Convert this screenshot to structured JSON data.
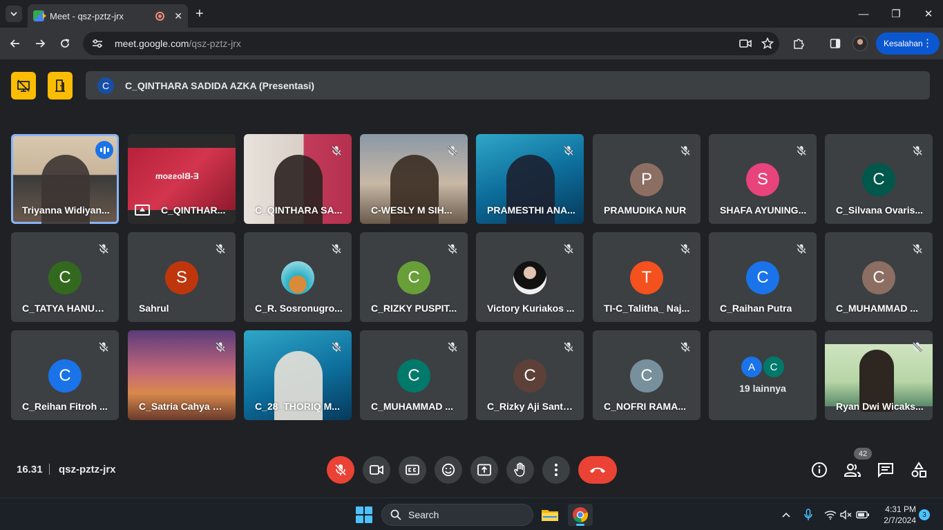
{
  "browser": {
    "tab_title": "Meet - qsz-pztz-jrx",
    "tab_close": "✕",
    "new_tab": "+",
    "url_domain": "meet.google.com",
    "url_path": "/qsz-pztz-jrx",
    "error_label": "Kesalahan",
    "error_menu": "⋮",
    "window_controls": {
      "minimize": "—",
      "restore": "❐",
      "close": "✕"
    }
  },
  "meet": {
    "presenter_initial": "C",
    "presenter_label": "C_QINTHARA SADIDA AZKA (Presentasi)",
    "tiles": [
      {
        "name": "Triyanna Widiyan...",
        "kind": "video",
        "speaking": true
      },
      {
        "name": "C_QINTHAR...",
        "kind": "presentation",
        "slide_text": "E-Blossom"
      },
      {
        "name": "C_QINTHARA SA...",
        "kind": "video"
      },
      {
        "name": "C-WESLY M SIH...",
        "kind": "video"
      },
      {
        "name": "PRAMESTHI ANA...",
        "kind": "video"
      },
      {
        "name": "PRAMUDIKA NUR",
        "kind": "avatar",
        "initial": "P",
        "color": "#8d6e63"
      },
      {
        "name": "SHAFA AYUNING...",
        "kind": "avatar",
        "initial": "S",
        "color": "#e8437a"
      },
      {
        "name": "C_Silvana Ovaris...",
        "kind": "avatar",
        "initial": "C",
        "color": "#00574b"
      },
      {
        "name": "C_TATYA HANUM...",
        "kind": "avatar",
        "initial": "C",
        "color": "#33691e"
      },
      {
        "name": "Sahrul",
        "kind": "avatar",
        "initial": "S",
        "color": "#bf360c"
      },
      {
        "name": "C_R. Sosronugro...",
        "kind": "photo-avatar"
      },
      {
        "name": "C_RIZKY PUSPIT...",
        "kind": "avatar",
        "initial": "C",
        "color": "#689f38"
      },
      {
        "name": "Victory Kuriakos ...",
        "kind": "photo-avatar"
      },
      {
        "name": "TI-C_Talitha_ Naj...",
        "kind": "avatar",
        "initial": "T",
        "color": "#f4511e"
      },
      {
        "name": "C_Raihan Putra",
        "kind": "avatar",
        "initial": "C",
        "color": "#1a73e8"
      },
      {
        "name": "C_MUHAMMAD ...",
        "kind": "avatar",
        "initial": "C",
        "color": "#8d6e63"
      },
      {
        "name": "C_Reihan Fitroh ...",
        "kind": "avatar",
        "initial": "C",
        "color": "#1a73e8"
      },
      {
        "name": "C_Satria Cahya R...",
        "kind": "video"
      },
      {
        "name": "C_28_THORIQ M...",
        "kind": "video"
      },
      {
        "name": "C_MUHAMMAD ...",
        "kind": "avatar",
        "initial": "C",
        "color": "#00796b"
      },
      {
        "name": "C_Rizky Aji Santo...",
        "kind": "avatar",
        "initial": "C",
        "color": "#5d4037"
      },
      {
        "name": "C_NOFRI RAMA...",
        "kind": "avatar",
        "initial": "C",
        "color": "#78909c"
      },
      {
        "name": "19 lainnya",
        "kind": "others",
        "initials": [
          "A",
          "C"
        ],
        "colors": [
          "#1a73e8",
          "#00796b"
        ]
      },
      {
        "name": "Ryan Dwi Wicaks...",
        "kind": "video"
      }
    ],
    "time": "16.31",
    "meeting_code": "qsz-pztz-jrx",
    "participant_count": "42"
  },
  "taskbar": {
    "search_label": "Search",
    "time": "4:31 PM",
    "date": "2/7/2024",
    "notification_count": "3"
  },
  "colors": {
    "accent_blue": "#8ab4f8",
    "danger_red": "#ea4335",
    "meet_yellow": "#fbbc04",
    "surface": "#3c4043"
  }
}
